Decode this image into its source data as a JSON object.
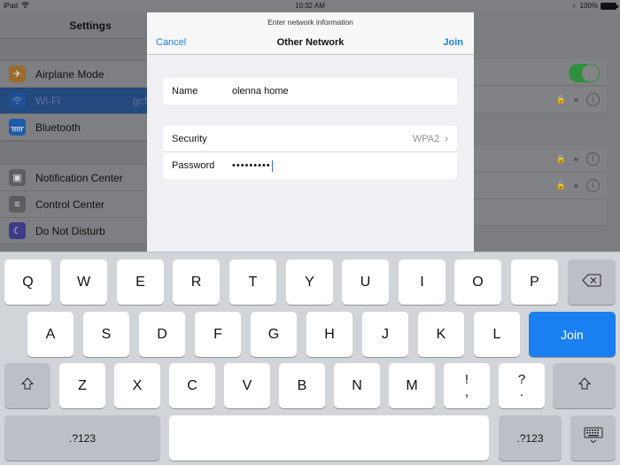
{
  "status_bar": {
    "device": "iPad",
    "time": "10:32 AM",
    "battery": "100%",
    "wifi_icon": "wifi-icon",
    "bluetooth_icon": "bluetooth-icon"
  },
  "sidebar": {
    "title": "Settings",
    "items": [
      {
        "label": "Airplane Mode",
        "icon": "airplane-icon",
        "color": "#9b6a2c"
      },
      {
        "label": "Wi-Fi",
        "icon": "wifi-icon",
        "color": "#1f4f94",
        "value": "gcflea"
      },
      {
        "label": "Bluetooth",
        "icon": "bluetooth-icon",
        "color": "#1f5aa8"
      },
      {
        "label": "Notification Center",
        "icon": "notification-icon",
        "color": "#5c5d60"
      },
      {
        "label": "Control Center",
        "icon": "control-center-icon",
        "color": "#5c5d60"
      },
      {
        "label": "Do Not Disturb",
        "icon": "moon-icon",
        "color": "#3f3a8a"
      }
    ]
  },
  "modal": {
    "prompt": "Enter network information",
    "title": "Other Network",
    "cancel_label": "Cancel",
    "join_label": "Join",
    "name_label": "Name",
    "name_value": "olenna home",
    "security_label": "Security",
    "security_value": "WPA2",
    "password_label": "Password",
    "password_value": "•••••••••"
  },
  "keyboard": {
    "row1": [
      "Q",
      "W",
      "E",
      "R",
      "T",
      "Y",
      "U",
      "I",
      "O",
      "P"
    ],
    "row2": [
      "A",
      "S",
      "D",
      "F",
      "G",
      "H",
      "J",
      "K",
      "L"
    ],
    "row3": [
      "Z",
      "X",
      "C",
      "V",
      "B",
      "N",
      "M"
    ],
    "punct1": {
      "top": "!",
      "bottom": ","
    },
    "punct2": {
      "top": "?",
      "bottom": "."
    },
    "join_label": "Join",
    "numbers_label": ".?123",
    "accent_color": "#1a7ff0"
  }
}
